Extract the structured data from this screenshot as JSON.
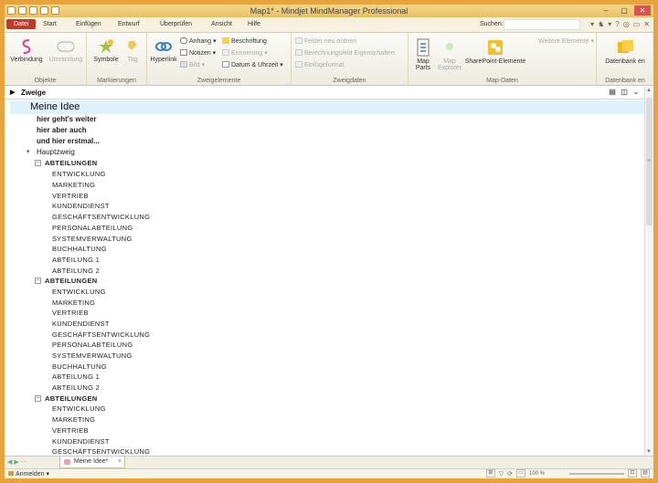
{
  "titlebar": {
    "title": "Map1* - Mindjet MindManager Professional",
    "controls": [
      "–",
      "▢",
      "✕"
    ]
  },
  "tabs": {
    "items": [
      "Datei",
      "Start",
      "Einfügen",
      "Entwurf",
      "Überprüfen",
      "Ansicht",
      "Hilfe"
    ],
    "search_label": "Suchen:",
    "search_value": "",
    "right_icons": [
      "▾",
      "♞",
      "▾",
      "?",
      "◎",
      "▭",
      "✕"
    ]
  },
  "ribbon": {
    "objects": {
      "label": "Objekte",
      "connection": "Verbindung",
      "boundary": "Umrandung"
    },
    "markers": {
      "label": "Markierungen",
      "symbols": "Symbole",
      "tag": "Tag"
    },
    "topic_elements": {
      "label": "Zweigelemente",
      "hyperlink": "Hyperlink",
      "attachment": "Anhang",
      "notes": "Notizen",
      "image": "Bild",
      "caption": "Beschriftung",
      "alert": "Erinnerung",
      "dates": "Datum & Uhrzeit"
    },
    "topics": {
      "label": "Zweigdaten",
      "r1": "Felder neu ordnen",
      "r2": "Berechnungsfeld Eigenschaften",
      "r3": "Einfügeformat"
    },
    "map_data": {
      "label": "Map-Daten",
      "map_parts": "Map Parts",
      "map_explorer": "Map Explorer",
      "sharepoint": "SharePoint-Elemente",
      "more": "Weitere Elemente"
    },
    "database": {
      "label": "Datenbank en",
      "button": "Datenbank en"
    }
  },
  "outline": {
    "header": "Zweige",
    "root": "Meine Idee",
    "notes": [
      "hier geht's weiter",
      "hier aber auch",
      "und hier erstmal..."
    ],
    "main_branch": "Hauptzweig",
    "groups": [
      {
        "title": "ABTEILUNGEN",
        "items": [
          "ENTWICKLUNG",
          "MARKETING",
          "VERTRIEB",
          "KUNDENDIENST",
          "GESCHÄFTSENTWICKLUNG",
          "PERSONALABTEILUNG",
          "SYSTEMVERWALTUNG",
          "BUCHHALTUNG",
          "ABTEILUNG 1",
          "ABTEILUNG 2"
        ]
      },
      {
        "title": "ABTEILUNGEN",
        "items": [
          "ENTWICKLUNG",
          "MARKETING",
          "VERTRIEB",
          "KUNDENDIENST",
          "GESCHÄFTSENTWICKLUNG",
          "PERSONALABTEILUNG",
          "SYSTEMVERWALTUNG",
          "BUCHHALTUNG",
          "ABTEILUNG 1",
          "ABTEILUNG 2"
        ]
      },
      {
        "title": "ABTEILUNGEN",
        "items": [
          "ENTWICKLUNG",
          "MARKETING",
          "VERTRIEB",
          "KUNDENDIENST",
          "GESCHÄFTSENTWICKLUNG"
        ]
      }
    ]
  },
  "doctabs": {
    "tab_label": "Meine Idee*",
    "close": "×"
  },
  "statusbar": {
    "login": "Anmelden",
    "zoom": "100 %"
  },
  "colors": {
    "frame": "#e8a33c",
    "file_tab": "#c0392b",
    "root_highlight": "#dff1fb"
  }
}
